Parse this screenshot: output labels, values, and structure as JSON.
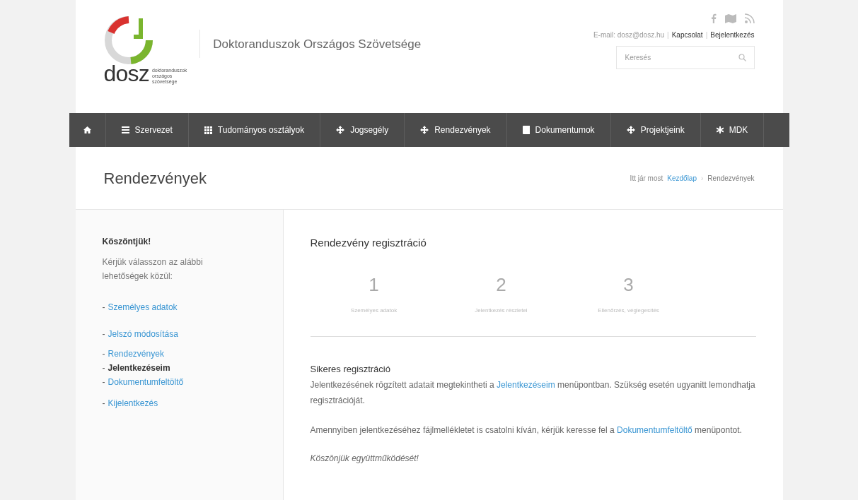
{
  "header": {
    "site_title": "Doktoranduszok Országos Szövetsége",
    "logo_text": "dosz",
    "logo_subtitle": [
      "doktoranduszok",
      "országos",
      "szövetsége"
    ],
    "email": "E-mail: dosz@dosz.hu",
    "link_separator": "|",
    "top_links": [
      "Kapcsolat",
      "Bejelentkezés"
    ],
    "search": {
      "placeholder": "Keresés"
    }
  },
  "nav": [
    {
      "kind": "home"
    },
    {
      "kind": "list",
      "label": "Szervezet"
    },
    {
      "kind": "grid",
      "label": "Tudományos osztályok"
    },
    {
      "kind": "move",
      "label": "Jogsegély"
    },
    {
      "kind": "move",
      "label": "Rendezvények"
    },
    {
      "kind": "book",
      "label": "Dokumentumok"
    },
    {
      "kind": "move",
      "label": "Projektjeink"
    },
    {
      "kind": "asterisk",
      "label": "MDK"
    }
  ],
  "page_title": "Rendezvények",
  "breadcrumb": {
    "prefix": "Itt jár most",
    "separator": "›",
    "items": [
      "Kezdőlap",
      "Rendezvények"
    ]
  },
  "sidebar": {
    "title": "Köszöntjük!",
    "intro": "Kérjük válasszon az alábbi lehetőségek közül:",
    "item_marker": "-",
    "items": [
      {
        "label": "Személyes adatok",
        "selected": false
      },
      {
        "label": "Jelszó módosítása",
        "selected": false
      },
      {
        "label": "Rendezvények",
        "selected": false
      },
      {
        "label": "Jelentkezéseim",
        "selected": true
      },
      {
        "label": "Dokumentumfeltöltő",
        "selected": false
      },
      {
        "label": "Kijelentkezés",
        "selected": false
      }
    ]
  },
  "main": {
    "title": "Rendezvény regisztráció",
    "steps": [
      {
        "number": "1",
        "label": "Személyes adatok"
      },
      {
        "number": "2",
        "label": "Jelentkezés részletei"
      },
      {
        "number": "3",
        "label": "Ellenőrzés, véglegesítés"
      }
    ],
    "success_title": "Sikeres regisztráció",
    "paragraphs": [
      {
        "before": "Jelentkezésének rögzített adatait megtekintheti a ",
        "link": "Jelentkezéseim",
        "after": " menüpontban. Szükség esetén ugyanitt lemondhatja regisztrációját."
      },
      {
        "before": "Amennyiben jelentkezéséhez fájlmellékletet is csatolni kíván, kérjük keresse fel a ",
        "link": "Dokumentumfeltöltő",
        "after": " menüpontot."
      }
    ],
    "thanks": "Köszönjük együttműködését!"
  }
}
